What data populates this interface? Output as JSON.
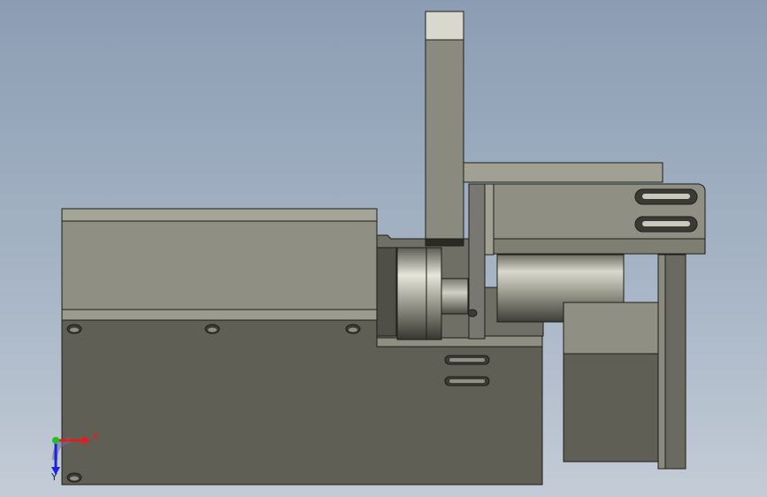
{
  "viewport": {
    "background_top": "#8c9db3",
    "background_bottom": "#c3ccd6"
  },
  "triad": {
    "x_label": "X",
    "y_label": "Y",
    "x_color": "#e02020",
    "y_color": "#20c020",
    "z_color": "#2020e0"
  },
  "materials": {
    "body_dark": "#5f5f56",
    "body_mid": "#8a8a7e",
    "body_light": "#a5a597",
    "edge": "#1e1e1a"
  }
}
